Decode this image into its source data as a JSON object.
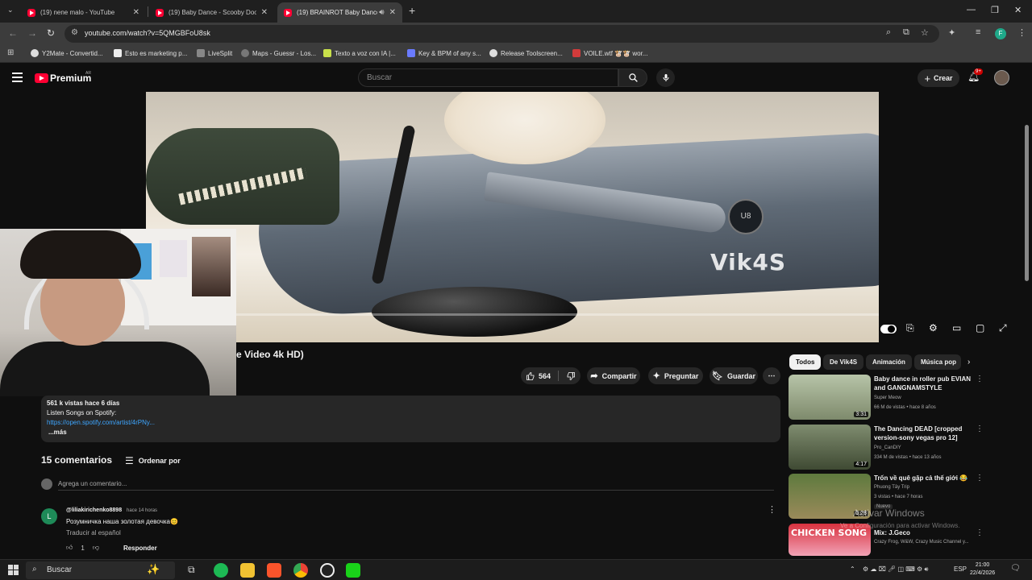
{
  "browser": {
    "tabs": [
      {
        "title": "(19) nene malo - YouTube",
        "active": false
      },
      {
        "title": "(19) Baby Dance - Scooby Doo",
        "active": false
      },
      {
        "title": "(19) BRAINROT Baby Dance",
        "active": true
      }
    ],
    "new_tab": "+",
    "url": "youtube.com/watch?v=5QMGBFoU8sk",
    "profile_initial": "F",
    "bookmarks": [
      "Y2Mate - Convertid...",
      "Esto es marketing p...",
      "LiveSplit",
      "Maps - Guessr - Los...",
      "Texto a voz con IA |...",
      "Key & BPM of any s...",
      "Release Toolscreen...",
      "VOILE.wtf 🐮🐮 wor..."
    ]
  },
  "youtube": {
    "logo_text": "Premium",
    "country_code": "AR",
    "search_placeholder": "Buscar",
    "create_label": "Crear",
    "notifications": "9+"
  },
  "video": {
    "watermark": "Vik4S",
    "emblem": "U8",
    "progress": 0.0,
    "title_visible": "e Video 4k HD)",
    "likes": "564",
    "share_label": "Compartir",
    "ask_label": "Preguntar",
    "save_label": "Guardar"
  },
  "description": {
    "stats": "561 k vistas  hace 6 días",
    "line2": "Listen Songs on Spotify:",
    "link": "https://open.spotify.com/artist/4rPNy...",
    "more": "...más"
  },
  "comments": {
    "count_label": "15 comentarios",
    "sort_label": "Ordenar por",
    "add_placeholder": "Agrega un comentario...",
    "items": [
      {
        "avatar_initial": "L",
        "user": "@liliakirichenko8898",
        "time": "hace 14 horas",
        "text": "Розумничка наша золотая девочка😊",
        "translate": "Traducir al español",
        "likes": "1",
        "reply_label": "Responder"
      }
    ]
  },
  "sidebar": {
    "chips": [
      "Todos",
      "De Vik4S",
      "Animación",
      "Música pop"
    ],
    "recommendations": [
      {
        "title": "Baby dance in roller pub EVIAN and GANGNAMSTYLE",
        "channel": "Super Meow",
        "meta": "66 M de vistas • hace 8 años",
        "duration": "3:31"
      },
      {
        "title": "The Dancing DEAD [cropped version-sony vegas pro 12]",
        "channel": "Pro_CanDIY",
        "meta": "334 M de vistas • hace 13 años",
        "duration": "4:17"
      },
      {
        "title": "Trốn về quê gặp cả thế giới 😂",
        "channel": "Phuong Tây Trip",
        "meta": "3 vistas • hace 7 horas",
        "badge": "Nuevo",
        "duration": "0:28"
      },
      {
        "title": "Mix: J.Geco",
        "channel": "Crazy Frog, W&W, Crazy Music Channel y...",
        "meta": "",
        "thumb_text": "CHICKEN SONG"
      }
    ]
  },
  "windows": {
    "activate_title": "Activar Windows",
    "activate_sub": "Ve a Configuración para activar Windows.",
    "taskbar_search": "Buscar",
    "lang": "ESP",
    "time": "21:00",
    "date": "22/4/2026"
  }
}
